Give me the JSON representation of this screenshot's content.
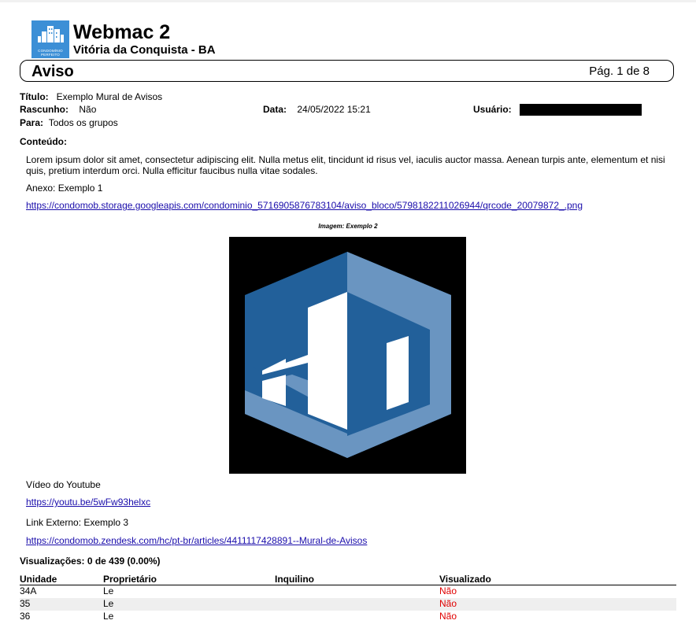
{
  "header": {
    "logo_caption_1": "CONDOMÍNIO",
    "logo_caption_2": "PERFEITO",
    "org_name": "Webmac 2",
    "city": "Vitória da Conquista - BA",
    "doc_type": "Aviso",
    "page_indicator": "Pág. 1 de 8"
  },
  "meta": {
    "titulo_label": "Título:",
    "titulo_value": "Exemplo Mural de Avisos",
    "rascunho_label": "Rascunho:",
    "rascunho_value": "Não",
    "data_label": "Data:",
    "data_value": "24/05/2022 15:21",
    "usuario_label": "Usuário:",
    "para_label": "Para:",
    "para_value": "Todos os grupos"
  },
  "content": {
    "label": "Conteúdo:",
    "text": "Lorem ipsum dolor sit amet, consectetur adipiscing elit. Nulla metus elit, tincidunt id risus vel, iaculis auctor massa. Aenean turpis ante, elementum et nisi quis, pretium interdum orci. Nulla efficitur faucibus nulla vitae sodales.",
    "attachment_label": "Anexo: Exemplo 1",
    "attachment_link": "https://condomob.storage.googleapis.com/condominio_5716905876783104/aviso_bloco/5798182211026944/qrcode_20079872_.png",
    "image_caption": "Imagem: Exemplo 2",
    "video_label": "Vídeo do Youtube",
    "video_link": "https://youtu.be/5wFw93helxc",
    "external_label": "Link Externo: Exemplo 3",
    "external_link": "https://condomob.zendesk.com/hc/pt-br/articles/4411117428891--Mural-de-Avisos"
  },
  "views": {
    "title": "Visualizações: 0 de 439 (0.00%)",
    "columns": [
      "Unidade",
      "Proprietário",
      "Inquilino",
      "Visualizado"
    ],
    "rows": [
      {
        "unidade": "34A",
        "proprietario": "Le",
        "inquilino": "",
        "visualizado": "Não"
      },
      {
        "unidade": "35",
        "proprietario": "Le",
        "inquilino": "",
        "visualizado": "Não"
      },
      {
        "unidade": "36",
        "proprietario": "Le",
        "inquilino": "",
        "visualizado": "Não"
      }
    ]
  },
  "colors": {
    "logo_bg": "#3c8fd6",
    "image_dark_blue": "#22609a",
    "image_light_blue": "#6a95c1",
    "link": "#1a0dab",
    "not_viewed": "#e00000"
  }
}
